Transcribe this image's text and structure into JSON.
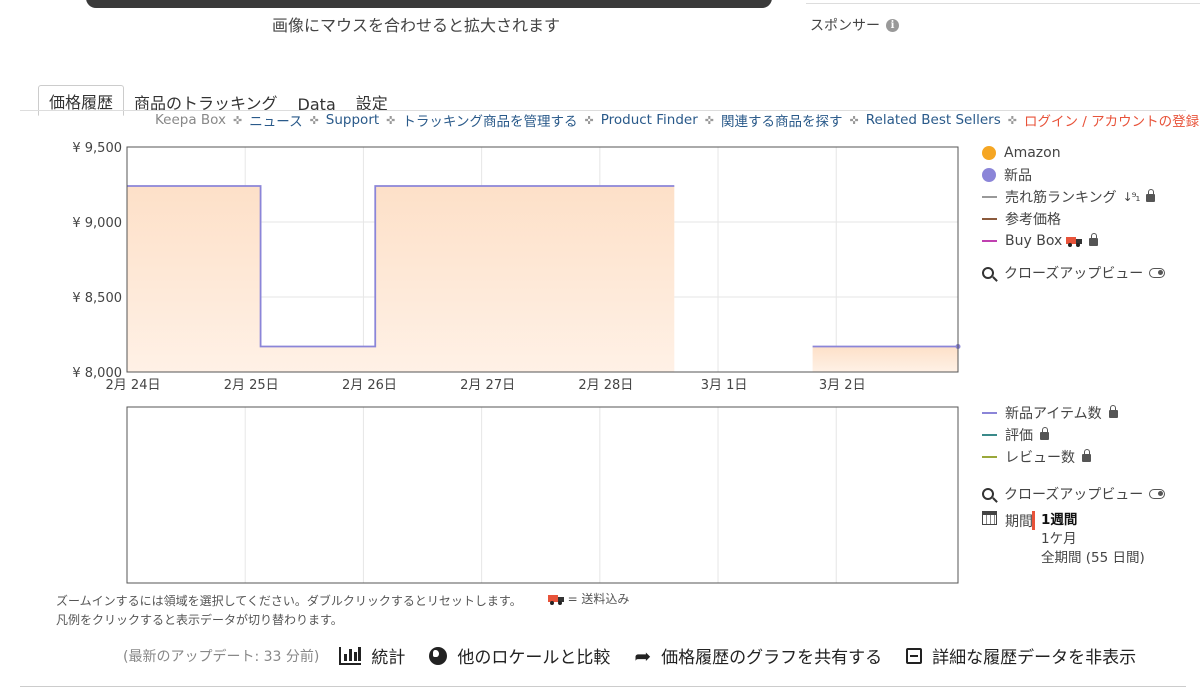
{
  "header": {
    "hover_hint": "画像にマウスを合わせると拡大されます",
    "sponsor": "スポンサー"
  },
  "tabs": [
    {
      "label": "価格履歴",
      "active": true
    },
    {
      "label": "商品のトラッキング",
      "active": false
    },
    {
      "label": "Data",
      "active": false
    },
    {
      "label": "設定",
      "active": false
    }
  ],
  "links": [
    {
      "label": "Keepa Box",
      "style": "plain"
    },
    {
      "label": "ニュース",
      "style": "link"
    },
    {
      "label": "Support",
      "style": "link"
    },
    {
      "label": "トラッキング商品を管理する",
      "style": "link"
    },
    {
      "label": "Product Finder",
      "style": "link"
    },
    {
      "label": "関連する商品を探す",
      "style": "link"
    },
    {
      "label": "Related Best Sellers",
      "style": "link"
    },
    {
      "label": "ログイン / アカウントの登録",
      "style": "login"
    }
  ],
  "chart_data": [
    {
      "type": "line",
      "y_tick_labels": [
        "¥ 9,500",
        "¥ 9,000",
        "¥ 8,500",
        "¥ 8,000"
      ],
      "x_tick_labels": [
        "2月 24日",
        "2月 25日",
        "2月 26日",
        "2月 27日",
        "2月 28日",
        "3月 1日",
        "3月 2日"
      ],
      "ylim": [
        8000,
        9500
      ],
      "xlim": [
        0,
        7.03
      ],
      "grid": true,
      "series": [
        {
          "name": "新品",
          "color": "#8b85d8",
          "fill": "#fde4d0",
          "segments": [
            [
              [
                0,
                9240
              ],
              [
                1.13,
                9240
              ],
              [
                1.13,
                8170
              ],
              [
                2.1,
                8170
              ],
              [
                2.1,
                9240
              ],
              [
                4.63,
                9240
              ]
            ],
            [
              [
                5.8,
                8170
              ],
              [
                7.03,
                8170
              ]
            ]
          ]
        }
      ]
    },
    {
      "type": "line",
      "x_tick_labels": [],
      "grid": true,
      "series": []
    }
  ],
  "legend_top": {
    "items": [
      {
        "label": "Amazon",
        "color": "#f5a623",
        "kind": "dot",
        "locked": false
      },
      {
        "label": "新品",
        "color": "#8b85d8",
        "kind": "dot",
        "locked": false
      },
      {
        "label": "売れ筋ランキング",
        "color": "#999999",
        "kind": "dash",
        "locked": true,
        "rank_icon": true
      },
      {
        "label": "参考価格",
        "color": "#8b5a3c",
        "kind": "dash",
        "locked": false
      },
      {
        "label": "Buy Box",
        "color": "#c040b0",
        "kind": "dash",
        "locked": true,
        "truck": true
      }
    ],
    "closeup": "クローズアップビュー"
  },
  "legend_bottom": {
    "items": [
      {
        "label": "新品アイテム数",
        "color": "#8b85d8",
        "locked": true
      },
      {
        "label": "評価",
        "color": "#3a8a8a",
        "locked": true
      },
      {
        "label": "レビュー数",
        "color": "#9aa83a",
        "locked": true
      }
    ],
    "closeup": "クローズアップビュー",
    "period_label": "期間",
    "period_options": [
      {
        "label": "1週間",
        "active": true
      },
      {
        "label": "1ケ月",
        "active": false
      },
      {
        "label": "全期間 (55 日間)",
        "active": false
      }
    ]
  },
  "notes": {
    "zoom": "ズームインするには領域を選択してください。ダブルクリックするとリセットします。",
    "shipping": "= 送料込み",
    "legend": "凡例をクリックすると表示データが切り替わります。"
  },
  "bottom": {
    "update": "(最新のアップデート: 33 分前)",
    "stats": "統計",
    "compare": "他のロケールと比較",
    "share": "価格履歴のグラフを共有する",
    "hide": "詳細な履歴データを非表示"
  }
}
